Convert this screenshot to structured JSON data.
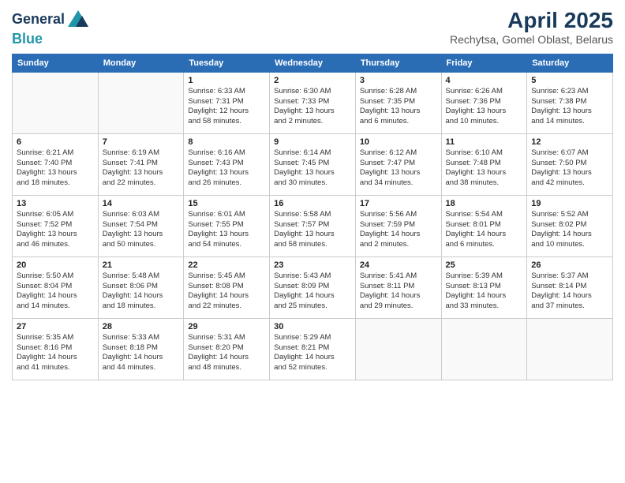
{
  "logo": {
    "line1": "General",
    "line2": "Blue"
  },
  "title": "April 2025",
  "subtitle": "Rechytsa, Gomel Oblast, Belarus",
  "weekdays": [
    "Sunday",
    "Monday",
    "Tuesday",
    "Wednesday",
    "Thursday",
    "Friday",
    "Saturday"
  ],
  "weeks": [
    [
      {
        "day": "",
        "info": ""
      },
      {
        "day": "",
        "info": ""
      },
      {
        "day": "1",
        "info": "Sunrise: 6:33 AM\nSunset: 7:31 PM\nDaylight: 12 hours\nand 58 minutes."
      },
      {
        "day": "2",
        "info": "Sunrise: 6:30 AM\nSunset: 7:33 PM\nDaylight: 13 hours\nand 2 minutes."
      },
      {
        "day": "3",
        "info": "Sunrise: 6:28 AM\nSunset: 7:35 PM\nDaylight: 13 hours\nand 6 minutes."
      },
      {
        "day": "4",
        "info": "Sunrise: 6:26 AM\nSunset: 7:36 PM\nDaylight: 13 hours\nand 10 minutes."
      },
      {
        "day": "5",
        "info": "Sunrise: 6:23 AM\nSunset: 7:38 PM\nDaylight: 13 hours\nand 14 minutes."
      }
    ],
    [
      {
        "day": "6",
        "info": "Sunrise: 6:21 AM\nSunset: 7:40 PM\nDaylight: 13 hours\nand 18 minutes."
      },
      {
        "day": "7",
        "info": "Sunrise: 6:19 AM\nSunset: 7:41 PM\nDaylight: 13 hours\nand 22 minutes."
      },
      {
        "day": "8",
        "info": "Sunrise: 6:16 AM\nSunset: 7:43 PM\nDaylight: 13 hours\nand 26 minutes."
      },
      {
        "day": "9",
        "info": "Sunrise: 6:14 AM\nSunset: 7:45 PM\nDaylight: 13 hours\nand 30 minutes."
      },
      {
        "day": "10",
        "info": "Sunrise: 6:12 AM\nSunset: 7:47 PM\nDaylight: 13 hours\nand 34 minutes."
      },
      {
        "day": "11",
        "info": "Sunrise: 6:10 AM\nSunset: 7:48 PM\nDaylight: 13 hours\nand 38 minutes."
      },
      {
        "day": "12",
        "info": "Sunrise: 6:07 AM\nSunset: 7:50 PM\nDaylight: 13 hours\nand 42 minutes."
      }
    ],
    [
      {
        "day": "13",
        "info": "Sunrise: 6:05 AM\nSunset: 7:52 PM\nDaylight: 13 hours\nand 46 minutes."
      },
      {
        "day": "14",
        "info": "Sunrise: 6:03 AM\nSunset: 7:54 PM\nDaylight: 13 hours\nand 50 minutes."
      },
      {
        "day": "15",
        "info": "Sunrise: 6:01 AM\nSunset: 7:55 PM\nDaylight: 13 hours\nand 54 minutes."
      },
      {
        "day": "16",
        "info": "Sunrise: 5:58 AM\nSunset: 7:57 PM\nDaylight: 13 hours\nand 58 minutes."
      },
      {
        "day": "17",
        "info": "Sunrise: 5:56 AM\nSunset: 7:59 PM\nDaylight: 14 hours\nand 2 minutes."
      },
      {
        "day": "18",
        "info": "Sunrise: 5:54 AM\nSunset: 8:01 PM\nDaylight: 14 hours\nand 6 minutes."
      },
      {
        "day": "19",
        "info": "Sunrise: 5:52 AM\nSunset: 8:02 PM\nDaylight: 14 hours\nand 10 minutes."
      }
    ],
    [
      {
        "day": "20",
        "info": "Sunrise: 5:50 AM\nSunset: 8:04 PM\nDaylight: 14 hours\nand 14 minutes."
      },
      {
        "day": "21",
        "info": "Sunrise: 5:48 AM\nSunset: 8:06 PM\nDaylight: 14 hours\nand 18 minutes."
      },
      {
        "day": "22",
        "info": "Sunrise: 5:45 AM\nSunset: 8:08 PM\nDaylight: 14 hours\nand 22 minutes."
      },
      {
        "day": "23",
        "info": "Sunrise: 5:43 AM\nSunset: 8:09 PM\nDaylight: 14 hours\nand 25 minutes."
      },
      {
        "day": "24",
        "info": "Sunrise: 5:41 AM\nSunset: 8:11 PM\nDaylight: 14 hours\nand 29 minutes."
      },
      {
        "day": "25",
        "info": "Sunrise: 5:39 AM\nSunset: 8:13 PM\nDaylight: 14 hours\nand 33 minutes."
      },
      {
        "day": "26",
        "info": "Sunrise: 5:37 AM\nSunset: 8:14 PM\nDaylight: 14 hours\nand 37 minutes."
      }
    ],
    [
      {
        "day": "27",
        "info": "Sunrise: 5:35 AM\nSunset: 8:16 PM\nDaylight: 14 hours\nand 41 minutes."
      },
      {
        "day": "28",
        "info": "Sunrise: 5:33 AM\nSunset: 8:18 PM\nDaylight: 14 hours\nand 44 minutes."
      },
      {
        "day": "29",
        "info": "Sunrise: 5:31 AM\nSunset: 8:20 PM\nDaylight: 14 hours\nand 48 minutes."
      },
      {
        "day": "30",
        "info": "Sunrise: 5:29 AM\nSunset: 8:21 PM\nDaylight: 14 hours\nand 52 minutes."
      },
      {
        "day": "",
        "info": ""
      },
      {
        "day": "",
        "info": ""
      },
      {
        "day": "",
        "info": ""
      }
    ]
  ]
}
